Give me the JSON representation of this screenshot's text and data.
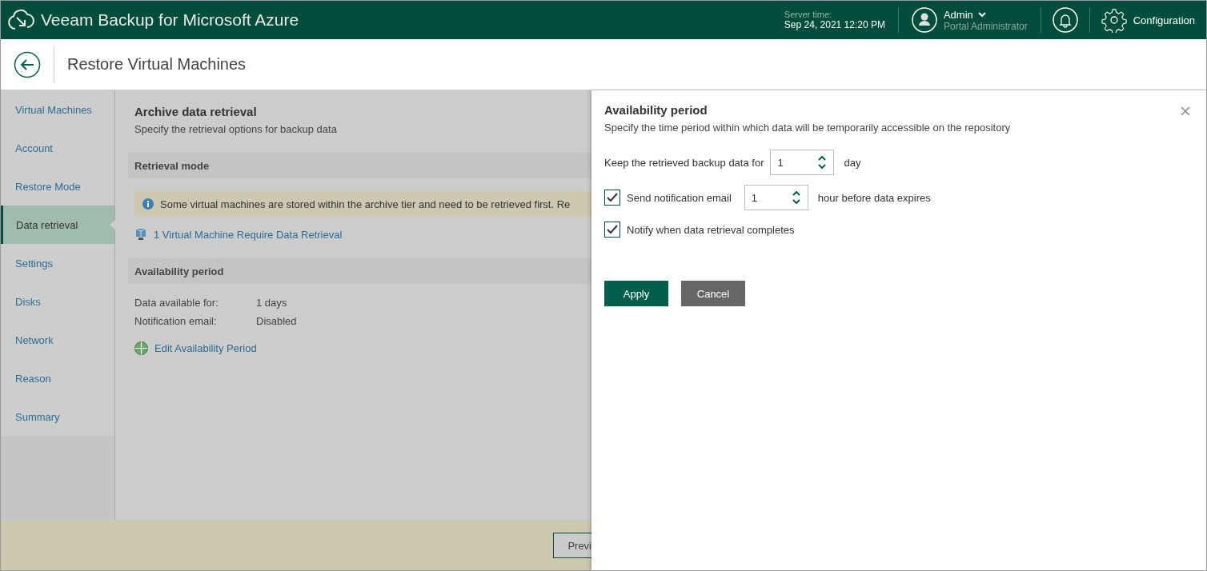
{
  "header": {
    "title": "Veeam Backup for Microsoft Azure",
    "server_time_label": "Server time:",
    "server_time": "Sep 24, 2021 12:20 PM",
    "user": "Admin",
    "role": "Portal Administrator",
    "configuration": "Configuration"
  },
  "page": {
    "title": "Restore Virtual Machines"
  },
  "steps": [
    {
      "label": "Virtual Machines",
      "selected": false
    },
    {
      "label": "Account",
      "selected": false
    },
    {
      "label": "Restore Mode",
      "selected": false
    },
    {
      "label": "Data retrieval",
      "selected": true
    },
    {
      "label": "Settings",
      "selected": false
    },
    {
      "label": "Disks",
      "selected": false
    },
    {
      "label": "Network",
      "selected": false
    },
    {
      "label": "Reason",
      "selected": false
    },
    {
      "label": "Summary",
      "selected": false
    }
  ],
  "main": {
    "title": "Archive data retrieval",
    "subtitle": "Specify the retrieval options for backup data",
    "retrieval_section": "Retrieval mode",
    "info": "Some virtual machines are stored within the archive tier and need to be retrieved first. Re",
    "vm_link": "1 Virtual Machine Require Data Retrieval",
    "availability_section": "Availability period",
    "details": [
      {
        "label": "Data available for:",
        "value": "1 days"
      },
      {
        "label": "Notification email:",
        "value": "Disabled"
      }
    ],
    "edit_link": "Edit Availability Period"
  },
  "footer": {
    "previous": "Previ"
  },
  "panel": {
    "title": "Availability period",
    "subtitle": "Specify the time period within which data will be temporarily accessible on the repository",
    "keep_label": "Keep the retrieved backup data for",
    "keep_value": "1",
    "keep_unit": "day",
    "notify_email": {
      "label": "Send notification email",
      "checked": true,
      "value": "1",
      "unit": "hour before data expires"
    },
    "notify_complete": {
      "label": "Notify when data retrieval completes",
      "checked": true
    },
    "apply": "Apply",
    "cancel": "Cancel"
  }
}
